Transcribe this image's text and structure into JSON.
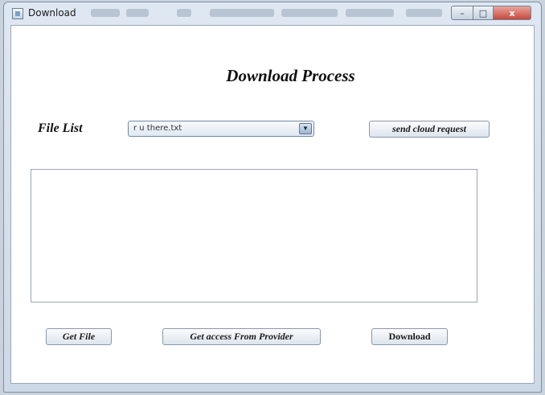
{
  "window": {
    "title": "Download",
    "close_glyph": "x",
    "maximize_glyph": "□",
    "minimize_glyph": "–"
  },
  "main": {
    "heading": "Download Process",
    "file_list_label": "File List",
    "file_combo": {
      "selected": "r u there.txt",
      "arrow_icon": "chevron-down-icon"
    },
    "send_cloud_request_label": "send cloud request",
    "text_area_value": "",
    "get_file_label": "Get File",
    "get_access_label": "Get access From Provider",
    "download_label": "Download"
  }
}
